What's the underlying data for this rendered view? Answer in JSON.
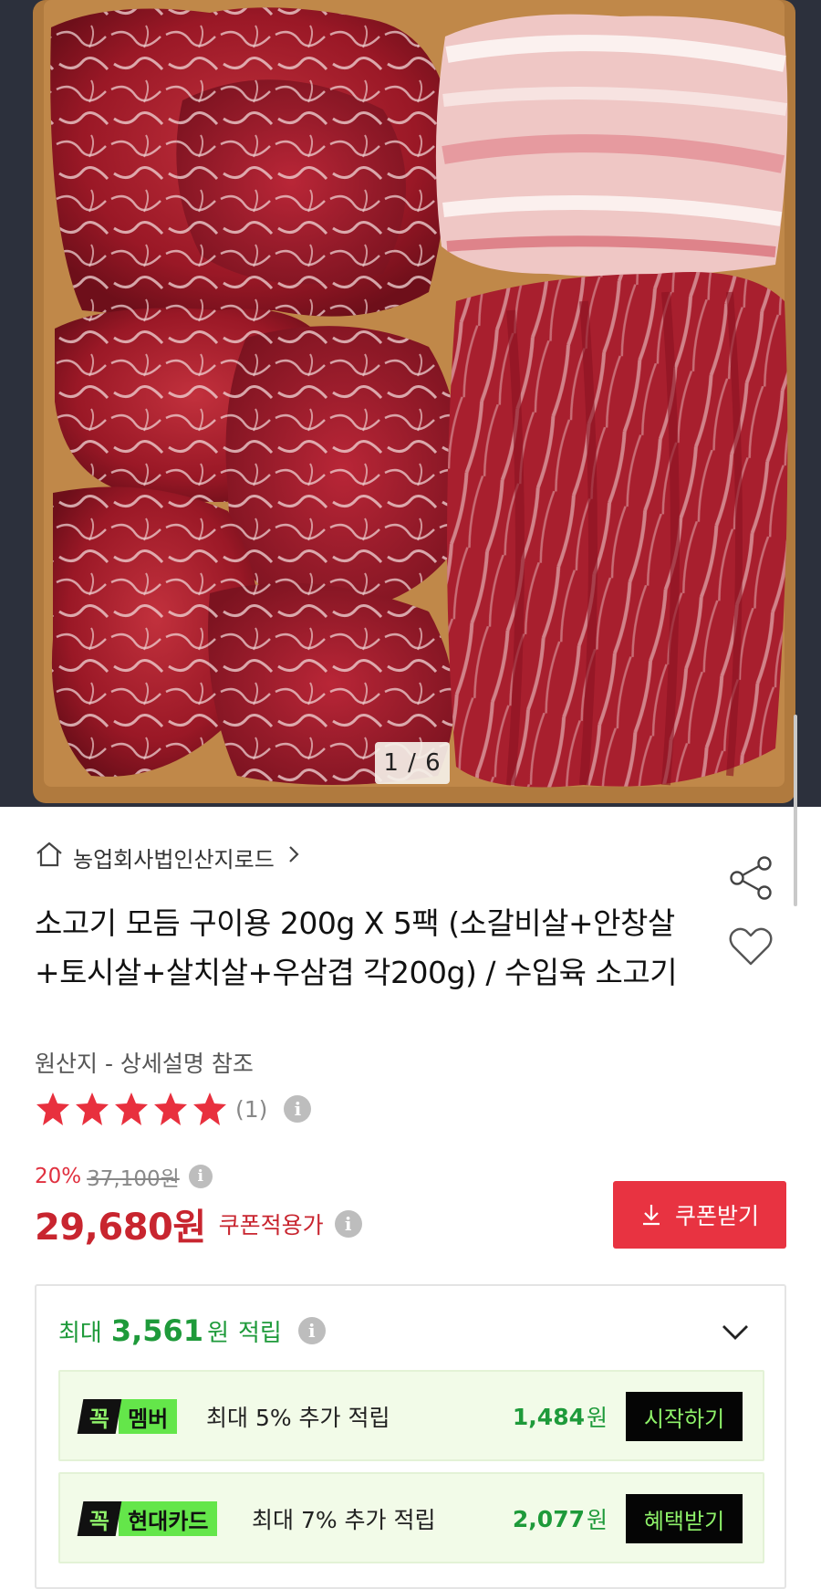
{
  "gallery": {
    "page_indicator": "1 / 6",
    "image_subject": "beef-assortment-photo"
  },
  "store": {
    "name": "농업회사법인산지로드",
    "icon": "home-icon"
  },
  "product": {
    "title": "소고기 모듬 구이용 200g X 5팩 (소갈비살+안창살+토시살+살치살+우삼겹 각200g) / 수입육 소고기",
    "origin": "원산지 - 상세설명 참조",
    "rating": {
      "stars": 5,
      "max_stars": 5,
      "count_text": "(1)"
    }
  },
  "pricing": {
    "discount_rate": "20%",
    "original_price": "37,100원",
    "price": "29,680원",
    "coupon_price_label": "쿠폰적용가",
    "coupon_button_label": "쿠폰받기"
  },
  "rewards": {
    "header_prefix": "최대",
    "header_amount": "3,561",
    "header_unit": "원",
    "header_suffix": "적립",
    "items": [
      {
        "badge_main": "꼭",
        "badge_tag": "멤버",
        "description": "최대 5% 추가 적립",
        "amount": "1,484",
        "unit": "원",
        "action": "시작하기"
      },
      {
        "badge_main": "꼭",
        "badge_tag": "현대카드",
        "description": "최대 7% 추가 적립",
        "amount": "2,077",
        "unit": "원",
        "action": "혜택받기"
      }
    ]
  },
  "icons": [
    "home-icon",
    "chevron-right-icon",
    "share-icon",
    "heart-icon",
    "star-icon",
    "info-icon",
    "download-icon",
    "chevron-down-icon"
  ],
  "colors": {
    "accent_red": "#e83341",
    "price_red": "#c8252f",
    "reward_green": "#1e9a3a",
    "badge_green": "#64e64a",
    "badge_text_green": "#8ff36a"
  }
}
